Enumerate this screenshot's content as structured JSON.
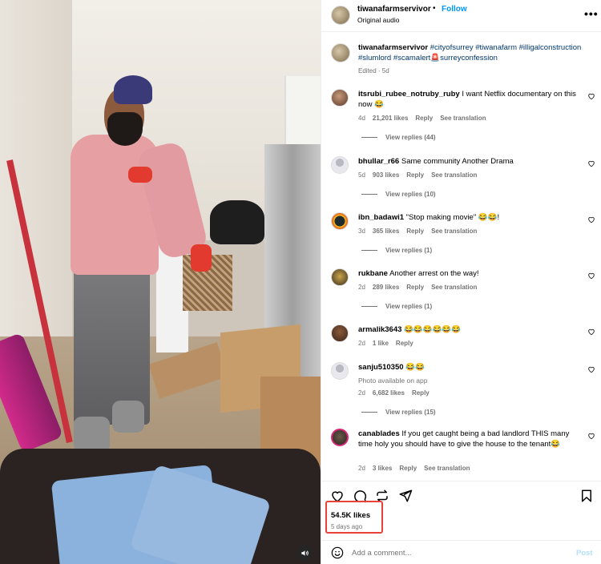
{
  "post": {
    "username": "tiwanafarmservivor",
    "dot": "•",
    "follow_label": "Follow",
    "audio": "Original audio",
    "more": "•••"
  },
  "caption": {
    "username": "tiwanafarmservivor",
    "tags": "#cityofsurrey #tiwanafarm #illigalconstruction #slumlord #scamalert🚨surreyconfession",
    "meta": "Edited · 5d"
  },
  "comments": [
    {
      "user": "itsrubi_rubee_notruby_ruby",
      "text": "I want Netflix documentary on this now 😂",
      "age": "4d",
      "likes": "21,201 likes",
      "reply": "Reply",
      "translate": "See translation",
      "view_replies": "View replies (44)"
    },
    {
      "user": "bhullar_r66",
      "text": "Same community Another Drama",
      "age": "5d",
      "likes": "903 likes",
      "reply": "Reply",
      "translate": "See translation",
      "view_replies": "View replies (10)"
    },
    {
      "user": "ibn_badawi1",
      "text": "\"Stop making movie\" 😂😂!",
      "age": "3d",
      "likes": "365 likes",
      "reply": "Reply",
      "translate": "See translation",
      "view_replies": "View replies (1)"
    },
    {
      "user": "rukbane",
      "text": "Another arrest on the way!",
      "age": "2d",
      "likes": "289 likes",
      "reply": "Reply",
      "translate": "See translation",
      "view_replies": "View replies (1)"
    },
    {
      "user": "armalik3643",
      "text": "😂😂😂😂😂😂",
      "age": "2d",
      "likes": "1 like",
      "reply": "Reply"
    },
    {
      "user": "sanju510350",
      "text": "😂😂",
      "note": "Photo available on app",
      "age": "2d",
      "likes": "6,682 likes",
      "reply": "Reply",
      "view_replies": "View replies (15)"
    },
    {
      "user": "canablades",
      "text": "If you get caught being a bad landlord THIS many time holy you should have to give the house to the tenant😂",
      "age": "2d",
      "likes": "3 likes",
      "reply": "Reply",
      "translate": "See translation"
    }
  ],
  "footer": {
    "likes": "54.5K likes",
    "ago": "5 days ago",
    "comment_placeholder": "Add a comment...",
    "post_label": "Post"
  },
  "colors": {
    "accent": "#0095f6",
    "highlight_box": "#e94339",
    "hashtag": "#00376b"
  }
}
